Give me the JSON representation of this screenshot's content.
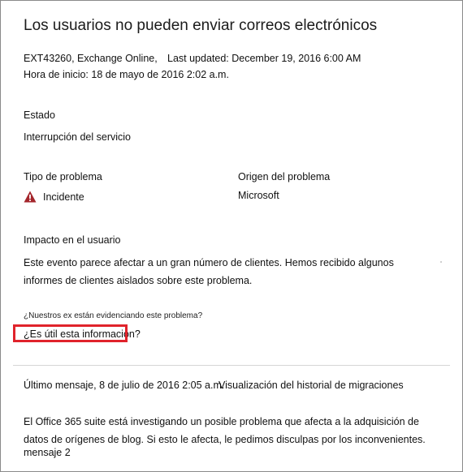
{
  "title": "Los usuarios no pueden enviar correos electrónicos",
  "meta": {
    "id_service": "EXT43260, Exchange Online,",
    "last_updated": "Last updated: December 19, 2016 6:00 AM",
    "start_time": "Hora de inicio: 18 de mayo de 2016 2:02 a.m."
  },
  "status": {
    "label": "Estado",
    "value": "Interrupción del servicio"
  },
  "issue_type": {
    "label": "Tipo de problema",
    "value": "Incidente",
    "icon": "warning-icon",
    "icon_color": "#a4262c"
  },
  "issue_origin": {
    "label": "Origen del problema",
    "value": "Microsoft"
  },
  "user_impact": {
    "label": "Impacto en el usuario",
    "text": "Este evento parece afectar a un gran número de clientes. Hemos recibido algunos informes de clientes aislados sobre este problema."
  },
  "feedback": {
    "question_small": "¿Nuestros ex están evidenciando este problema?",
    "question_useful": "¿Es útil esta información?",
    "highlight_color": "#e0232b"
  },
  "last_message": {
    "label": "Último mensaje, 8 de julio de 2016 2:05 a.m.",
    "history_link": "Visualización del historial de migraciones",
    "body": "El Office 365 suite está investigando un posible problema que afecta a la adquisición de datos de orígenes de blog. Si esto le afecta, le pedimos disculpas por los inconvenientes.",
    "tail": "mensaje 2"
  }
}
